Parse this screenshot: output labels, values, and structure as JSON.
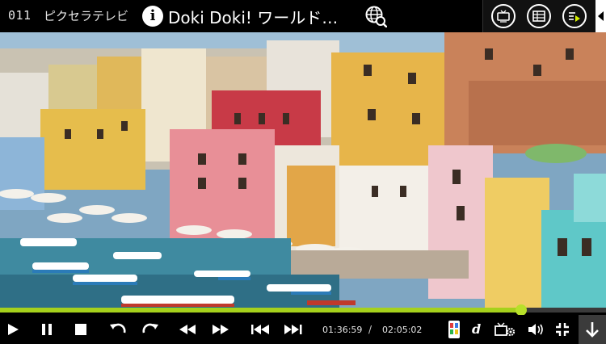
{
  "header": {
    "channel_number": "011",
    "channel_name": "ピクセラテレビ",
    "program_title": "Doki Doki! ワールド…"
  },
  "icons": {
    "info": "info-icon",
    "search": "search-globe-icon",
    "tv": "tv-icon",
    "epg": "program-guide-icon",
    "playlist": "playlist-play-icon",
    "collapse": "collapse-arrow-icon"
  },
  "playback": {
    "current_time": "01:36:59",
    "time_separator": "/",
    "total_time": "02:05:02",
    "progress": 0.86
  },
  "colors": {
    "accent": "#a6d11c",
    "background": "#000000"
  }
}
